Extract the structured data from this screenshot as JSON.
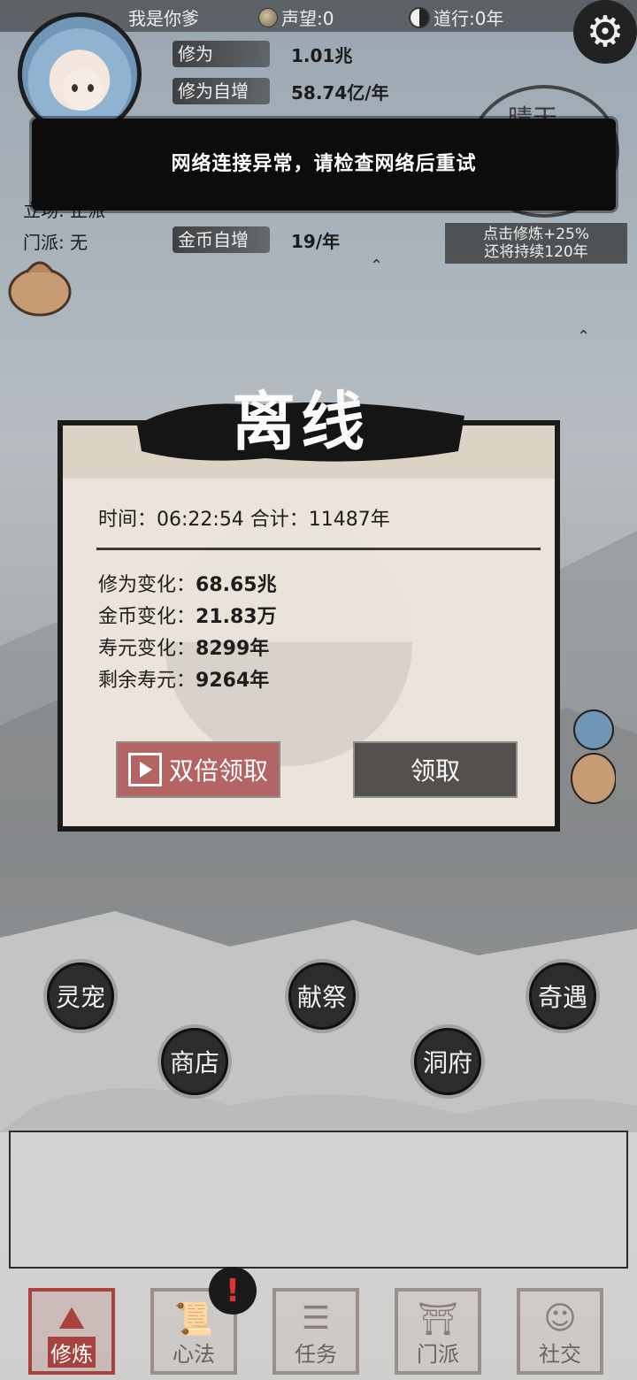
{
  "topbar": {
    "player_name": "我是你爹",
    "prestige": "声望:0",
    "dao": "道行:0年",
    "settings_icon": "gear-icon"
  },
  "stats": {
    "cultivation_label": "修为",
    "cultivation_value": "1.01兆",
    "cultivation_rate_label": "修为自增",
    "cultivation_rate_value": "58.74亿/年",
    "gold_rate_label": "金币自增",
    "gold_rate_value": "19/年"
  },
  "side": {
    "stance": "立场: 正派",
    "sect": "门派: 无"
  },
  "weather": "晴天",
  "boost": {
    "line1": "点击修炼+25%",
    "line2": "还将持续120年"
  },
  "toast": "网络连接异常，请检查网络后重试",
  "offline_modal": {
    "title": "离线",
    "time_line": "时间：06:22:54  合计：11487年",
    "cultivation_label": "修为变化：",
    "cultivation_value": "68.65兆",
    "gold_label": "金币变化：",
    "gold_value": "21.83万",
    "lifespan_label": "寿元变化：",
    "lifespan_value": "8299年",
    "remaining_label": "剩余寿元：",
    "remaining_value": "9264年",
    "double_button": "双倍领取",
    "claim_button": "领取"
  },
  "map_buttons": {
    "pet": "灵宠",
    "sacrifice": "献祭",
    "encounter": "奇遇",
    "shop": "商店",
    "cave": "洞府"
  },
  "bottom_nav": {
    "cultivate": "修炼",
    "method": "心法",
    "task": "任务",
    "sect": "门派",
    "social": "社交",
    "alert": "!"
  }
}
